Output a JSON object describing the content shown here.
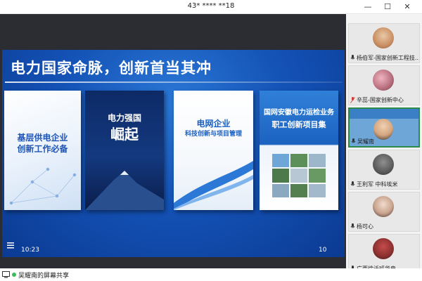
{
  "window": {
    "title": "43* **** **18",
    "controls": {
      "minimize": "—",
      "maximize": "☐",
      "close": "✕"
    }
  },
  "slide": {
    "title": "电力国家命脉，创新首当其冲",
    "time": "10:23",
    "page_number": "10",
    "books": [
      {
        "title_line1": "基层供电企业",
        "title_line2": "创新工作必备"
      },
      {
        "title_line1": "电力强国",
        "title_line2": "崛起"
      },
      {
        "title_line1": "电网企业",
        "title_line2": "科技创新与项目管理"
      },
      {
        "title_line1": "国网安徽电力运检业务",
        "title_line2": "职工创新项目集"
      }
    ]
  },
  "participants": [
    {
      "name": "杨伯军-国家创新工程技...",
      "mic": "on"
    },
    {
      "name": "辛蕊-国家创新中心",
      "mic": "off"
    },
    {
      "name": "吴耀南",
      "mic": "on",
      "active": true
    },
    {
      "name": "王利军 中科埃米",
      "mic": "on"
    },
    {
      "name": "杨可心",
      "mic": "on"
    },
    {
      "name": "广西徐沃班华电",
      "mic": "on"
    }
  ],
  "bottombar": {
    "share_label": "吴耀南的屏幕共享"
  },
  "colors": {
    "slide_blue": "#1453b7",
    "active_border": "#2c8a4b",
    "mic_off": "#d23b3b"
  }
}
